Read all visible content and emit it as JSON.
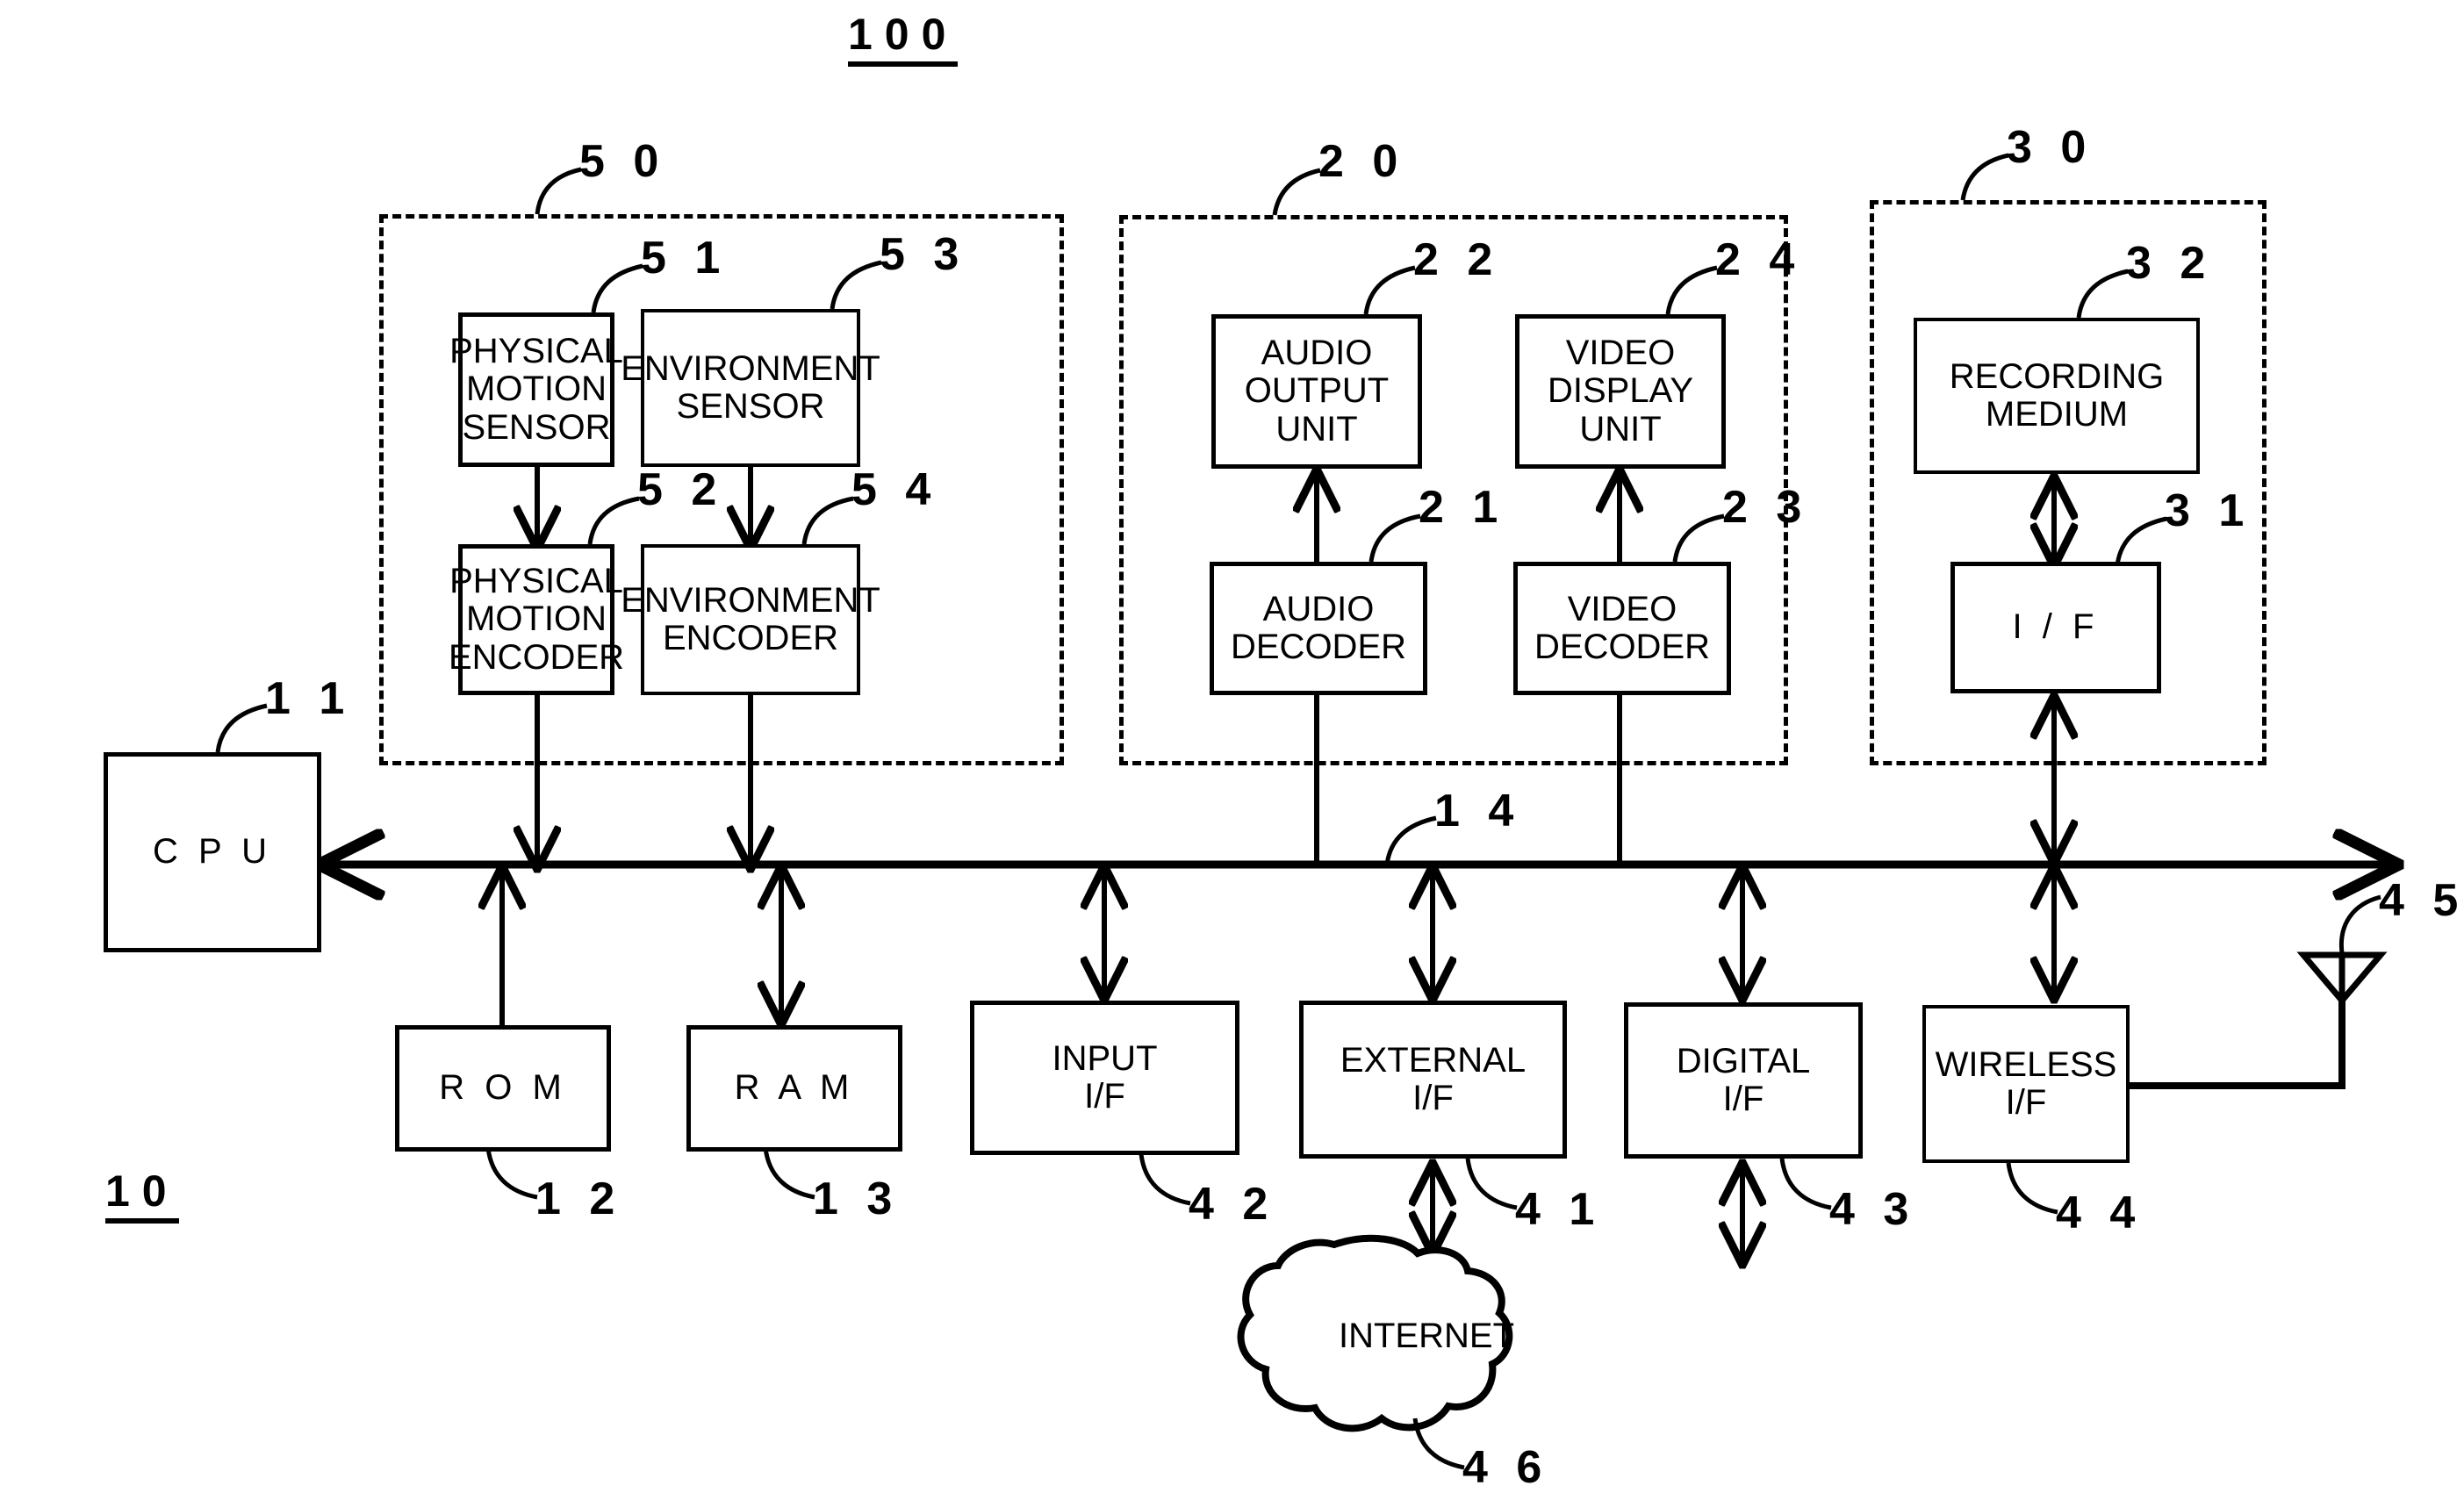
{
  "figure": {
    "system_label": "100",
    "device_label": "10"
  },
  "groups": [
    {
      "id": "sensor-group",
      "ref": "5 0"
    },
    {
      "id": "output-group",
      "ref": "2 0"
    },
    {
      "id": "recording-group",
      "ref": "3 0"
    }
  ],
  "blocks": {
    "physical_motion_sensor": {
      "label": "PHYSICAL\nMOTION\nSENSOR",
      "ref": "5 1"
    },
    "environment_sensor": {
      "label": "ENVIRONMENT\nSENSOR",
      "ref": "5 3"
    },
    "physical_motion_encoder": {
      "label": "PHYSICAL\nMOTION\nENCODER",
      "ref": "5 2"
    },
    "environment_encoder": {
      "label": "ENVIRONMENT\nENCODER",
      "ref": "5 4"
    },
    "audio_output_unit": {
      "label": "AUDIO\nOUTPUT\nUNIT",
      "ref": "2 2"
    },
    "video_display_unit": {
      "label": "VIDEO\nDISPLAY\nUNIT",
      "ref": "2 4"
    },
    "audio_decoder": {
      "label": "AUDIO\nDECODER",
      "ref": "2 1"
    },
    "video_decoder": {
      "label": "VIDEO\nDECODER",
      "ref": "2 3"
    },
    "recording_medium": {
      "label": "RECORDING\nMEDIUM",
      "ref": "3 2"
    },
    "recording_if": {
      "label": "I / F",
      "ref": "3 1"
    },
    "cpu": {
      "label": "C P U",
      "ref": "1 1"
    },
    "rom": {
      "label": "R O M",
      "ref": "1 2"
    },
    "ram": {
      "label": "R A M",
      "ref": "1 3"
    },
    "input_if": {
      "label": "INPUT\nI/F",
      "ref": "4 2"
    },
    "external_if": {
      "label": "EXTERNAL\nI/F",
      "ref": "4 1"
    },
    "digital_if": {
      "label": "DIGITAL\nI/F",
      "ref": "4 3"
    },
    "wireless_if": {
      "label": "WIRELESS\nI/F",
      "ref": "4 4"
    },
    "antenna": {
      "ref": "4 5"
    },
    "internet": {
      "label": "INTERNET",
      "ref": "4 6"
    },
    "bus": {
      "ref": "1 4"
    }
  }
}
